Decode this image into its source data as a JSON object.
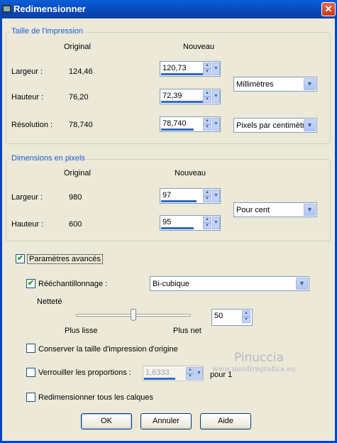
{
  "window": {
    "title": "Redimensionner",
    "close_symbol": "✕"
  },
  "print_size": {
    "group_title": "Taille de l'impression",
    "col_original": "Original",
    "col_new": "Nouveau",
    "width_label": "Largeur :",
    "width_original": "124,46",
    "width_new": "120,73",
    "height_label": "Hauteur :",
    "height_original": "76,20",
    "height_new": "72,39",
    "resolution_label": "Résolution :",
    "resolution_original": "78,740",
    "resolution_new": "78,740",
    "unit_value": "Millimètres",
    "resolution_unit_value": "Pixels par centimètre"
  },
  "pixel_size": {
    "group_title": "Dimensions en pixels",
    "col_original": "Original",
    "col_new": "Nouveau",
    "width_label": "Largeur :",
    "width_original": "980",
    "width_new": "97",
    "height_label": "Hauteur :",
    "height_original": "600",
    "height_new": "95",
    "unit_value": "Pour cent"
  },
  "advanced": {
    "checkbox_label": "Paramètres avancés",
    "checked": true,
    "resample_label": "Rééchantillonnage :",
    "resample_checked": true,
    "resample_value": "Bi-cubique",
    "sharpness_label": "Netteté",
    "sharpness_min_label": "Plus lisse",
    "sharpness_max_label": "Plus net",
    "sharpness_value": "50",
    "sharpness_level": 0.5,
    "keep_print_size_label": "Conserver la taille d'impression d'origine",
    "lock_ratio_label": "Verrouiller les proportions :",
    "ratio_value": "1,6333",
    "ratio_suffix": "pour 1",
    "resize_all_layers_label": "Redimensionner tous les calques"
  },
  "buttons": {
    "ok": "OK",
    "cancel": "Annuler",
    "help": "Aide"
  },
  "watermark": {
    "line1": "Pinuccia",
    "line2": "www.maidiregrafica.eu"
  },
  "check_mark": "✔",
  "arrows": {
    "up": "▲",
    "down": "▼"
  },
  "colors": {
    "title_bar": "#0846b8",
    "group_title": "#1d5bd5",
    "dialog_bg": "#ece9d8",
    "accent_bar": "#316ac5"
  }
}
